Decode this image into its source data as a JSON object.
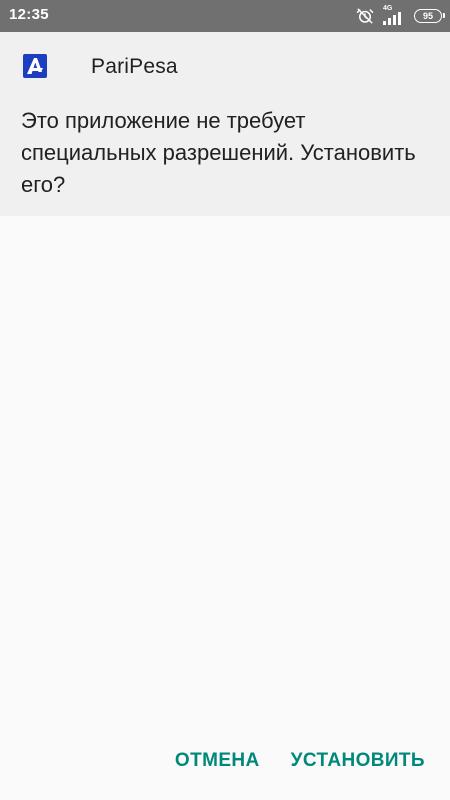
{
  "status_bar": {
    "time": "12:35",
    "network_type": "4G",
    "battery_level": "95",
    "icons": [
      "alarm-off-icon",
      "signal-icon",
      "battery-icon"
    ]
  },
  "header": {
    "app_name": "PariPesa",
    "app_icon": "paripesa-logo-icon",
    "message": "Это приложение не требует специальных разрешений. Установить его?"
  },
  "actions": {
    "cancel_label": "ОТМЕНА",
    "install_label": "УСТАНОВИТЬ"
  },
  "colors": {
    "status_bar": "#707070",
    "header_background": "#f0f0f0",
    "page_background": "#fafafa",
    "accent": "#00897b",
    "logo_blue": "#1d3fbf"
  }
}
